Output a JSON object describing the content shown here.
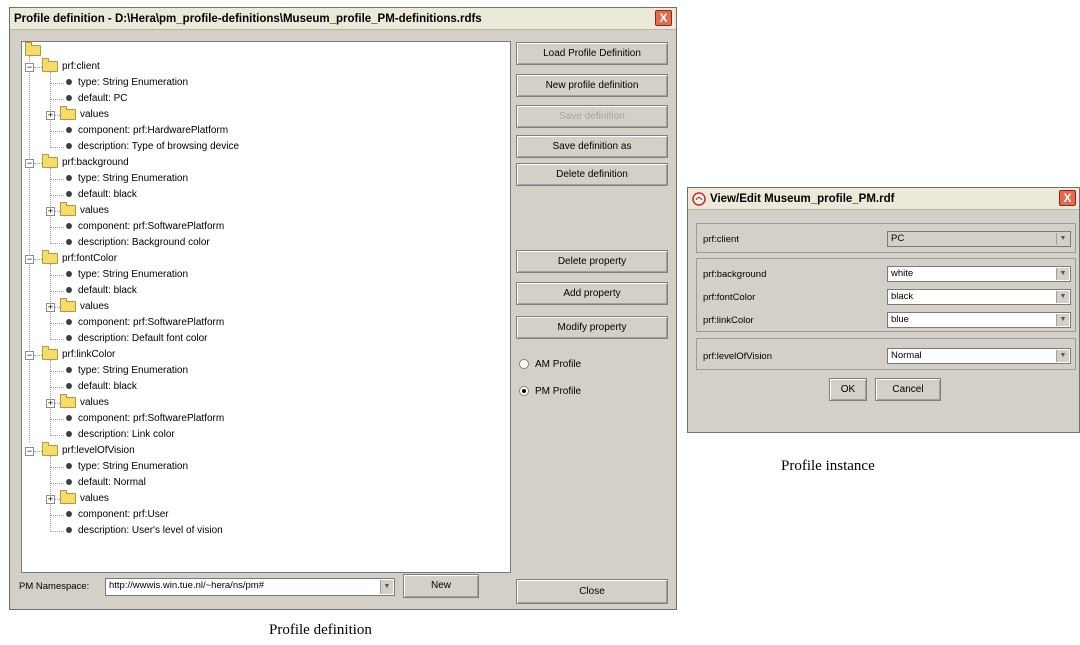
{
  "definition_window": {
    "title": "Profile definition - D:\\Hera\\pm_profile-definitions\\Museum_profile_PM-definitions.rdfs",
    "close_glyph": "X",
    "tree": {
      "properties": [
        {
          "name": "prf:client",
          "type": "type: String Enumeration",
          "default": "default: PC",
          "values": "values",
          "component": "component: prf:HardwarePlatform",
          "description": "description: Type of browsing device"
        },
        {
          "name": "prf:background",
          "type": "type: String Enumeration",
          "default": "default: black",
          "values": "values",
          "component": "component: prf:SoftwarePlatform",
          "description": "description: Background color"
        },
        {
          "name": "prf:fontColor",
          "type": "type: String Enumeration",
          "default": "default: black",
          "values": "values",
          "component": "component: prf:SoftwarePlatform",
          "description": "description: Default font color"
        },
        {
          "name": "prf:linkColor",
          "type": "type: String Enumeration",
          "default": "default: black",
          "values": "values",
          "component": "component: prf:SoftwarePlatform",
          "description": "description: Link color"
        },
        {
          "name": "prf:levelOfVision",
          "type": "type: String Enumeration",
          "default": "default: Normal",
          "values": "values",
          "component": "component: prf:User",
          "description": "description: User's level of vision"
        }
      ]
    },
    "buttons": {
      "load": "Load Profile Definition",
      "new_def": "New profile definition",
      "save": "Save definition",
      "save_as": "Save definition as",
      "delete_def": "Delete definition",
      "delete_prop": "Delete property",
      "add_prop": "Add property",
      "modify_prop": "Modify property",
      "close": "Close",
      "new_ns": "New"
    },
    "radios": {
      "am": "AM Profile",
      "pm": "PM Profile",
      "selected": "PM Profile"
    },
    "namespace": {
      "label": "PM Namespace:",
      "value": "http://wwwis.win.tue.nl/~hera/ns/pm#"
    }
  },
  "instance_window": {
    "title": "View/Edit Museum_profile_PM.rdf",
    "close_glyph": "X",
    "rows": [
      {
        "label": "prf:client",
        "value": "PC"
      },
      {
        "label": "prf:background",
        "value": "white"
      },
      {
        "label": "prf:fontColor",
        "value": "black"
      },
      {
        "label": "prf:linkColor",
        "value": "blue"
      },
      {
        "label": "prf:levelOfVision",
        "value": "Normal"
      }
    ],
    "ok": "OK",
    "cancel": "Cancel"
  },
  "captions": {
    "instance": "Profile instance",
    "definition": "Profile definition"
  },
  "icons": {
    "combo_arrow": "▼",
    "expand": "+",
    "collapse": "−"
  },
  "colors": {
    "window_bg": "#d4d0c8",
    "title_bg": "#ece9d8",
    "close_bg": "#e5694c",
    "folder": "#f5da6d"
  }
}
